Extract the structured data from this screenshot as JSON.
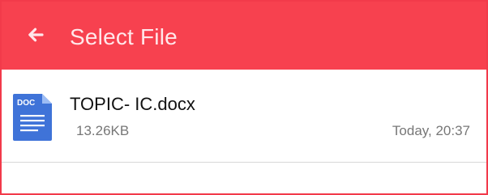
{
  "header": {
    "title": "Select File",
    "back_icon": "arrow-left-icon",
    "background_color": "#f7414f",
    "title_color": "#ffe7ea"
  },
  "files": [
    {
      "name": "TOPIC- IC.docx",
      "size": "13.26KB",
      "date": "Today,  20:37",
      "icon": "doc-file-icon",
      "icon_label": "DOC",
      "icon_color": "#3f73d8"
    }
  ]
}
